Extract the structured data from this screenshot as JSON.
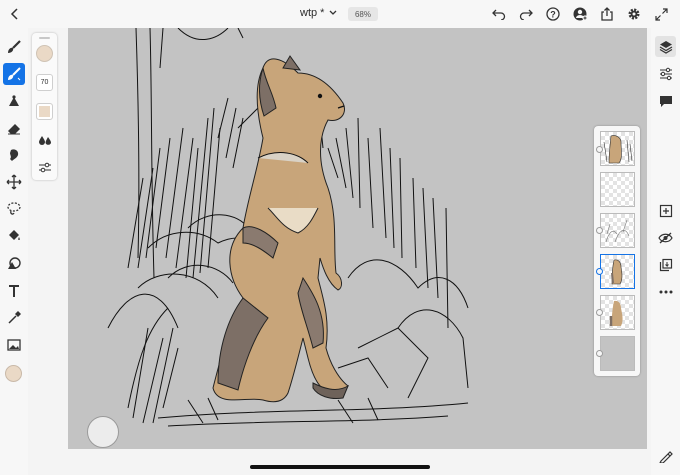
{
  "header": {
    "back_icon": "chevron-left-icon",
    "document_title": "wtp *",
    "title_menu_icon": "chevron-down-icon",
    "zoom_level": "68%",
    "actions": [
      {
        "name": "undo-button",
        "icon": "undo-icon"
      },
      {
        "name": "redo-button",
        "icon": "redo-icon"
      },
      {
        "name": "help-button",
        "icon": "help-icon"
      },
      {
        "name": "invite-button",
        "icon": "add-user-icon"
      },
      {
        "name": "share-button",
        "icon": "share-icon"
      },
      {
        "name": "settings-button",
        "icon": "gear-icon"
      },
      {
        "name": "fullscreen-button",
        "icon": "expand-icon"
      }
    ]
  },
  "left_toolbar": {
    "tools": [
      {
        "name": "pixel-brush-tool",
        "icon": "pixel-brush-icon",
        "active": false
      },
      {
        "name": "live-brush-tool",
        "icon": "live-brush-icon",
        "active": true
      },
      {
        "name": "vector-brush-tool",
        "icon": "vector-brush-icon",
        "active": false
      },
      {
        "name": "eraser-tool",
        "icon": "eraser-icon",
        "active": false
      },
      {
        "name": "smudge-tool",
        "icon": "smudge-icon",
        "active": false
      },
      {
        "name": "transform-tool",
        "icon": "move-icon",
        "active": false
      },
      {
        "name": "selection-tool",
        "icon": "lasso-icon",
        "active": false
      },
      {
        "name": "fill-tool",
        "icon": "paint-bucket-icon",
        "active": false
      },
      {
        "name": "shape-tool",
        "icon": "shape-icon",
        "active": false
      },
      {
        "name": "text-tool",
        "icon": "text-icon",
        "active": false
      },
      {
        "name": "eyedropper-tool",
        "icon": "eyedropper-icon",
        "active": false
      },
      {
        "name": "place-image-tool",
        "icon": "image-icon",
        "active": false
      }
    ],
    "current_color": "#ead9c6"
  },
  "brush_panel": {
    "size_value": "70",
    "color": "#ead9c6"
  },
  "layers_panel": {
    "layers": [
      {
        "name": "layer-1",
        "type": "artwork-full",
        "selected": false
      },
      {
        "name": "layer-2",
        "type": "empty",
        "selected": false
      },
      {
        "name": "layer-3",
        "type": "sketch-lines",
        "selected": false
      },
      {
        "name": "layer-4",
        "type": "artwork-small",
        "selected": true
      },
      {
        "name": "layer-5",
        "type": "artwork-color",
        "selected": false
      },
      {
        "name": "layer-6",
        "type": "background-gray",
        "selected": false
      }
    ]
  },
  "right_toolbar": {
    "items": [
      {
        "name": "layers-toggle-button",
        "icon": "layers-icon",
        "active": true
      },
      {
        "name": "layer-properties-button",
        "icon": "sliders-icon",
        "active": false
      },
      {
        "name": "comments-button",
        "icon": "comment-icon",
        "active": false
      },
      {
        "name": "add-layer-button",
        "icon": "add-layer-icon",
        "active": false
      },
      {
        "name": "hide-layer-button",
        "icon": "eye-slash-icon",
        "active": false
      },
      {
        "name": "merge-down-button",
        "icon": "merge-icon",
        "active": false
      },
      {
        "name": "more-actions-button",
        "icon": "more-icon",
        "active": false
      },
      {
        "name": "brush-settings-button",
        "icon": "brush-edit-icon",
        "active": false
      }
    ]
  },
  "colors": {
    "accent": "#1473e6",
    "canvas_background": "#c3c3c3",
    "fur_light": "#c8a57a",
    "fur_dark": "#7d6f66"
  }
}
